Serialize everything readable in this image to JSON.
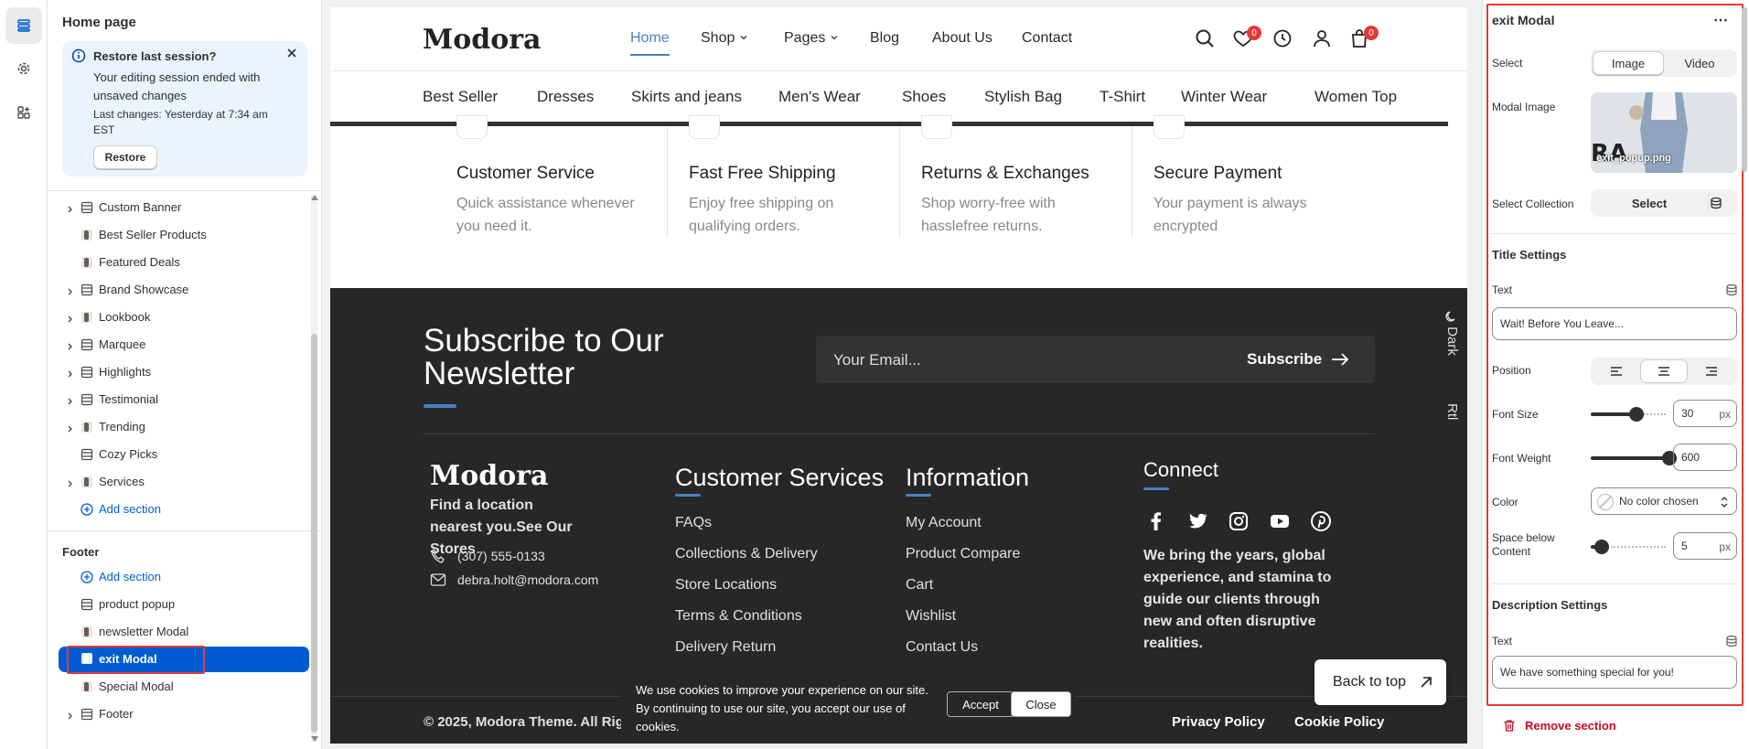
{
  "left_rail": {
    "items": [
      "sections-icon",
      "settings-icon",
      "apps-icon"
    ]
  },
  "editor": {
    "page_title": "Home page",
    "restore": {
      "title": "Restore last session?",
      "body": "Your editing session ended with unsaved changes",
      "last_changes": "Last changes: Yesterday at 7:34 am EST",
      "button": "Restore"
    },
    "sections": [
      {
        "label": "Custom Banner",
        "expandable": true
      },
      {
        "label": "Best Seller Products",
        "expandable": false
      },
      {
        "label": "Featured Deals",
        "expandable": false
      },
      {
        "label": "Brand Showcase",
        "expandable": true
      },
      {
        "label": "Lookbook",
        "expandable": true
      },
      {
        "label": "Marquee",
        "expandable": true
      },
      {
        "label": "Highlights",
        "expandable": true
      },
      {
        "label": "Testimonial",
        "expandable": true
      },
      {
        "label": "Trending",
        "expandable": true
      },
      {
        "label": "Cozy Picks",
        "expandable": false
      },
      {
        "label": "Services",
        "expandable": true
      }
    ],
    "add_section": "Add section",
    "footer_group": {
      "title": "Footer",
      "add_section": "Add section",
      "items": [
        {
          "label": "product popup",
          "expandable": false
        },
        {
          "label": "newsletter Modal",
          "expandable": false
        },
        {
          "label": "exit Modal",
          "expandable": false,
          "selected": true
        },
        {
          "label": "Special Modal",
          "expandable": false
        },
        {
          "label": "Footer",
          "expandable": true
        }
      ]
    }
  },
  "preview": {
    "logo": "Modora",
    "menu": [
      "Home",
      "Shop",
      "Pages",
      "Blog",
      "About Us",
      "Contact"
    ],
    "wishlist_count": "0",
    "cart_count": "0",
    "categories": [
      "Best Seller",
      "Dresses",
      "Skirts and jeans",
      "Men's Wear",
      "Shoes",
      "Stylish Bag",
      "T-Shirt",
      "Winter Wear",
      "Women Top"
    ],
    "features": [
      {
        "title": "Customer Service",
        "desc": "Quick assistance whenever you need it."
      },
      {
        "title": "Fast Free Shipping",
        "desc": "Enjoy free shipping on qualifying orders."
      },
      {
        "title": "Returns & Exchanges",
        "desc": "Shop worry-free with hasslefree returns."
      },
      {
        "title": "Secure Payment",
        "desc": "Your payment is always encrypted"
      }
    ],
    "newsletter": {
      "title": "Subscribe to Our Newsletter",
      "email_placeholder": "Your Email...",
      "button": "Subscribe",
      "dark_label": "Dark",
      "rtl_label": "Rtl"
    },
    "footer": {
      "logo": "Modora",
      "tagline": "Find a location nearest you.See Our Stores",
      "phone": "(307) 555-0133",
      "email": "debra.holt@modora.com",
      "customer_services": {
        "title": "Customer Services",
        "links": [
          "FAQs",
          "Collections & Delivery",
          "Store Locations",
          "Terms & Conditions",
          "Delivery Return"
        ]
      },
      "information": {
        "title": "Information",
        "links": [
          "My Account",
          "Product Compare",
          "Cart",
          "Wishlist",
          "Contact Us"
        ]
      },
      "connect": {
        "title": "Connect",
        "social": [
          "facebook-icon",
          "twitter-icon",
          "instagram-icon",
          "youtube-icon",
          "pinterest-icon"
        ],
        "text": "We bring the years, global experience, and stamina to guide our clients through new and often disruptive realities."
      },
      "copyright": "© 2025, Modora Theme. All Rights",
      "privacy": "Privacy Policy",
      "cookie_policy": "Cookie Policy"
    },
    "cookie_banner": {
      "text": "We use cookies to improve your experience on our site. By continuing to use our site, you accept our use of cookies.",
      "accept": "Accept",
      "close": "Close"
    },
    "back_to_top": "Back to top"
  },
  "settings": {
    "title": "exit Modal",
    "select_label": "Select",
    "select_options": [
      "Image",
      "Video"
    ],
    "selected_option": "Image",
    "modal_image_label": "Modal Image",
    "modal_image_file": "exit_popup.png",
    "modal_image_overlay_text": "RA",
    "select_collection_label": "Select Collection",
    "select_collection_button": "Select",
    "title_settings": {
      "heading": "Title Settings",
      "text_label": "Text",
      "text_value": "Wait! Before You Leave...",
      "position_label": "Position",
      "font_size_label": "Font Size",
      "font_size_value": "30",
      "font_size_range": [
        10,
        60
      ],
      "font_weight_label": "Font Weight",
      "font_weight_value": "600",
      "color_label": "Color",
      "color_value": "No color chosen",
      "space_below_label": "Space below Content",
      "space_below_value": "5",
      "unit": "px"
    },
    "description_settings": {
      "heading": "Description Settings",
      "text_label": "Text",
      "text_value": "We have something special for you!"
    },
    "remove_section": "Remove section"
  },
  "colors": {
    "accent": "#005bd3",
    "highlight_box": "#e53935",
    "brand_blue": "#4a7fc1",
    "footer_bg": "#272727"
  }
}
